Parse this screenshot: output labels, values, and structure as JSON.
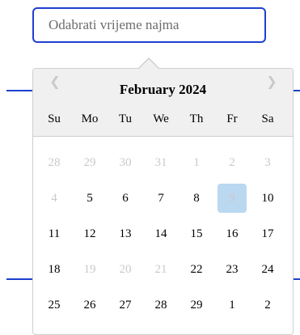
{
  "search": {
    "placeholder": "Odabrati vrijeme najma"
  },
  "calendar": {
    "month_label": "February 2024",
    "prev_icon": "chevron-left-icon",
    "next_icon": "chevron-right-icon",
    "weekdays": [
      "Su",
      "Mo",
      "Tu",
      "We",
      "Th",
      "Fr",
      "Sa"
    ],
    "weeks": [
      [
        {
          "d": "28",
          "m": true
        },
        {
          "d": "29",
          "m": true
        },
        {
          "d": "30",
          "m": true
        },
        {
          "d": "31",
          "m": true
        },
        {
          "d": "1",
          "m": true
        },
        {
          "d": "2",
          "m": true
        },
        {
          "d": "3",
          "m": true
        }
      ],
      [
        {
          "d": "4",
          "m": true
        },
        {
          "d": "5",
          "m": false
        },
        {
          "d": "6",
          "m": false
        },
        {
          "d": "7",
          "m": false
        },
        {
          "d": "8",
          "m": false
        },
        {
          "d": "9",
          "m": true,
          "sel": true
        },
        {
          "d": "10",
          "m": false
        }
      ],
      [
        {
          "d": "11",
          "m": false
        },
        {
          "d": "12",
          "m": false
        },
        {
          "d": "13",
          "m": false
        },
        {
          "d": "14",
          "m": false
        },
        {
          "d": "15",
          "m": false
        },
        {
          "d": "16",
          "m": false
        },
        {
          "d": "17",
          "m": false
        }
      ],
      [
        {
          "d": "18",
          "m": false
        },
        {
          "d": "19",
          "m": true
        },
        {
          "d": "20",
          "m": true
        },
        {
          "d": "21",
          "m": true
        },
        {
          "d": "22",
          "m": false
        },
        {
          "d": "23",
          "m": false
        },
        {
          "d": "24",
          "m": false
        }
      ],
      [
        {
          "d": "25",
          "m": false
        },
        {
          "d": "26",
          "m": false
        },
        {
          "d": "27",
          "m": false
        },
        {
          "d": "28",
          "m": false
        },
        {
          "d": "29",
          "m": false
        },
        {
          "d": "1",
          "m": false
        },
        {
          "d": "2",
          "m": false
        }
      ]
    ],
    "colors": {
      "accent": "#1f3fd1",
      "selected_bg": "#bad8f0",
      "muted": "#c9c9c9",
      "header_bg": "#f0f0f0"
    }
  }
}
